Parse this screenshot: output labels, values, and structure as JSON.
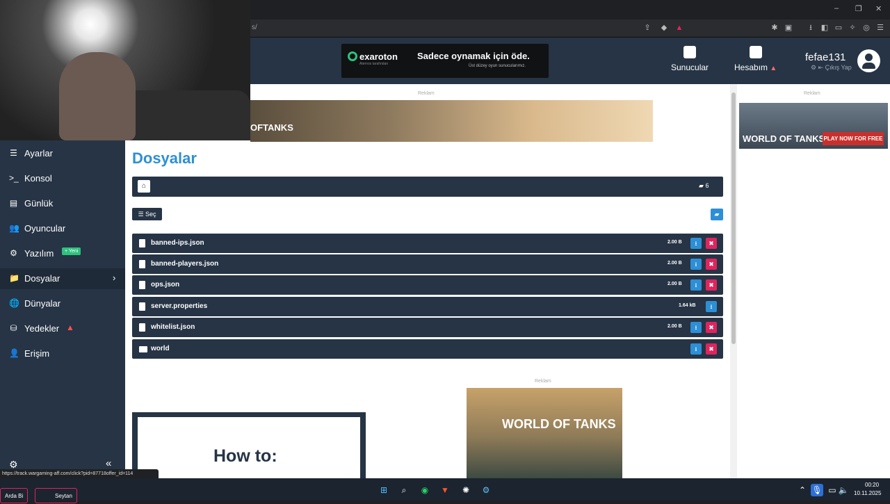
{
  "browser": {
    "url": "s/",
    "window_controls": [
      "–",
      "❐",
      "✕"
    ]
  },
  "header": {
    "banner_ad": {
      "brand": "exaroton",
      "brand_sub": "Aternos tarafından",
      "headline": "Sadece oynamak için öde.",
      "tagline": "Üst düzey oyun sunucularımız."
    },
    "nav_servers": "Sunucular",
    "nav_account": "Hesabım",
    "user_name": "fefae131",
    "logout": "Çıkış Yap"
  },
  "ads": {
    "label": "Reklam",
    "wot_logo": "WORLD OF TANKS",
    "wot_logo_short": "OFTANKS",
    "wot_cta": "PLAY NOW FOR FREE"
  },
  "sidebar": {
    "items": [
      {
        "label": "Ayarlar",
        "icon": "☰"
      },
      {
        "label": "Konsol",
        "icon": ">_"
      },
      {
        "label": "Günlük",
        "icon": "▤"
      },
      {
        "label": "Oyuncular",
        "icon": "👥"
      },
      {
        "label": "Yazılım",
        "icon": "⚙"
      },
      {
        "label": "Dosyalar",
        "icon": "📁"
      },
      {
        "label": "Dünyalar",
        "icon": "🌐"
      },
      {
        "label": "Yedekler",
        "icon": "⛁"
      },
      {
        "label": "Erişim",
        "icon": "👤"
      }
    ],
    "badge_new": "+ Yeni",
    "warn_icon": "▲"
  },
  "main": {
    "title": "Dosyalar",
    "folder_count": "6",
    "select_label": "Seç",
    "files": [
      {
        "name": "banned-ips.json",
        "size": "2.00 B",
        "deletable": true
      },
      {
        "name": "banned-players.json",
        "size": "2.00 B",
        "deletable": true
      },
      {
        "name": "ops.json",
        "size": "2.00 B",
        "deletable": true
      },
      {
        "name": "server.properties",
        "size": "1.64 kB",
        "deletable": false
      },
      {
        "name": "whitelist.json",
        "size": "2.00 B",
        "deletable": true
      },
      {
        "name": "world",
        "size": "",
        "deletable": true
      }
    ],
    "howto_text": "How to:"
  },
  "status_link": "https://track.wargaming-aff.com/click?pid=87718offer_id=114",
  "taskbar": {
    "left_apps": [
      "Arda Bi",
      "Seytan"
    ],
    "time": "00:20",
    "date": "10.11.2025"
  },
  "colors": {
    "accent": "#2d8fd5",
    "dark_panel": "#263445",
    "danger": "#e0245e",
    "success": "#2ec27e"
  }
}
